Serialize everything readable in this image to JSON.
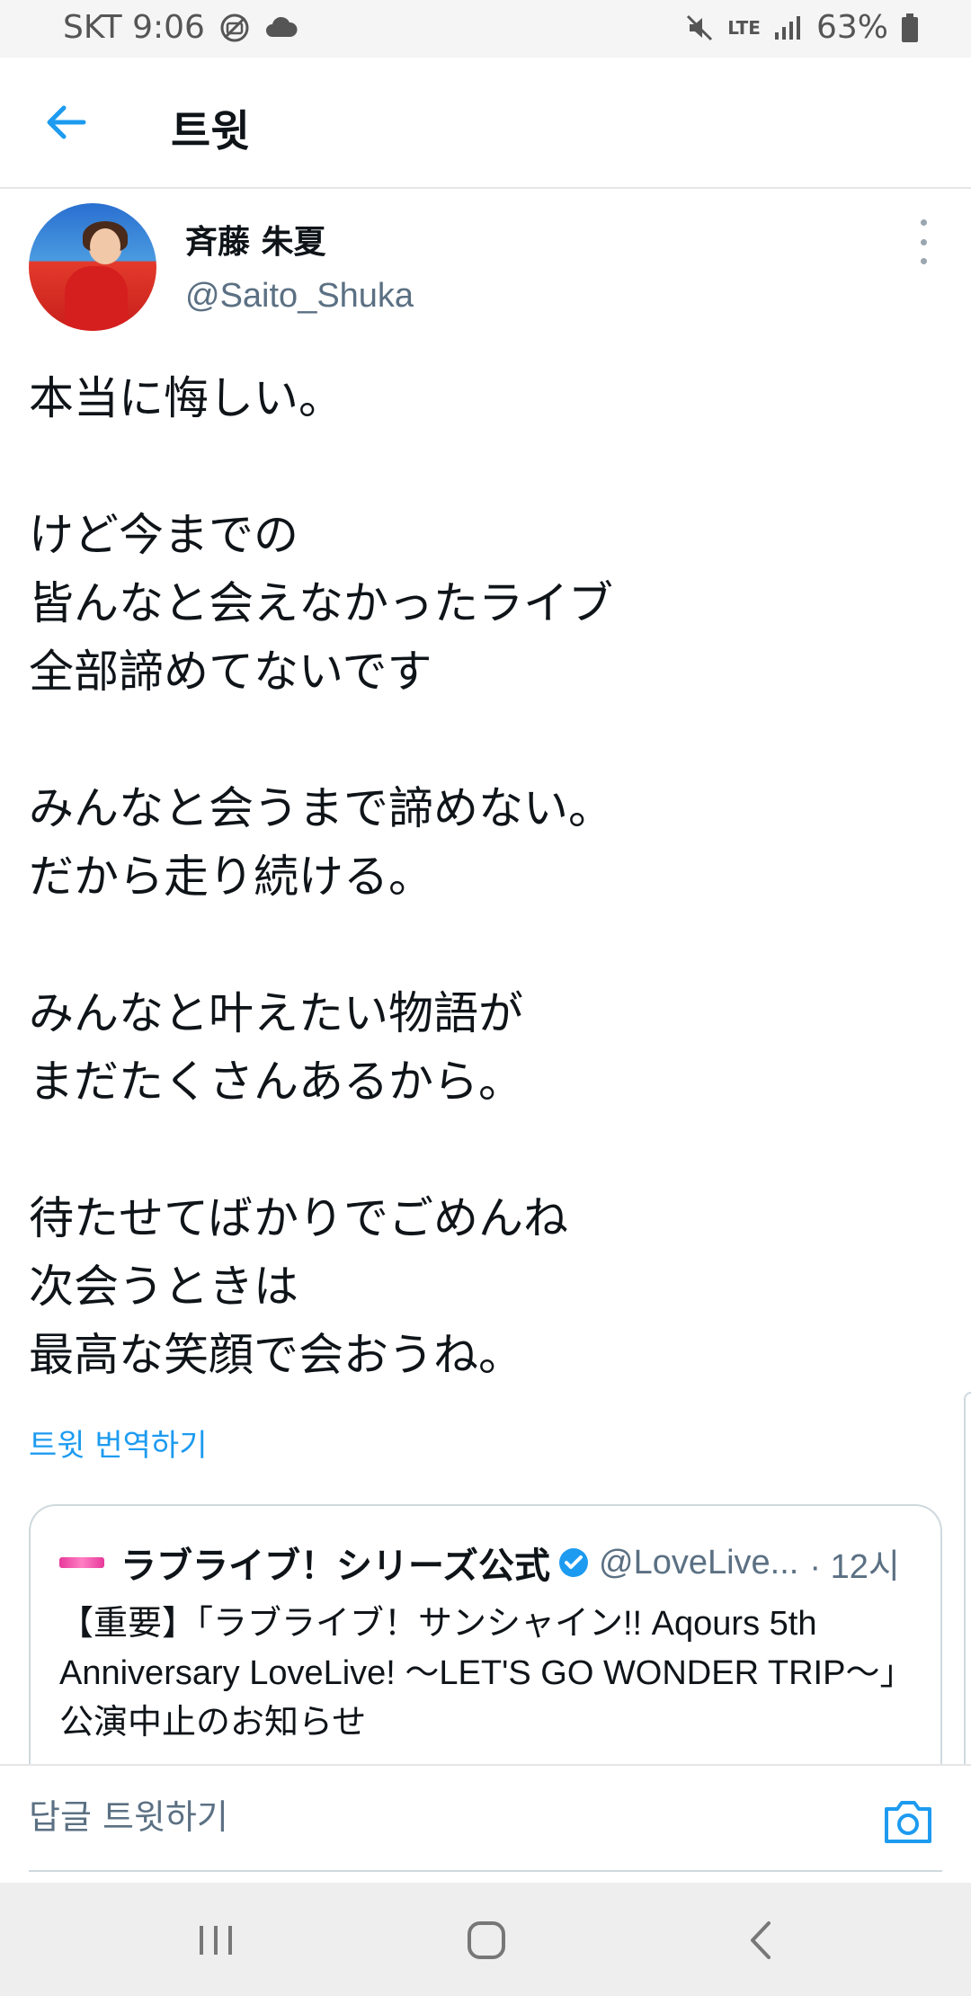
{
  "status_bar": {
    "carrier_time": "SKT 9:06",
    "network": "LTE",
    "battery": "63%"
  },
  "header": {
    "title": "트윗"
  },
  "tweet": {
    "display_name": "斉藤 朱夏",
    "handle": "@Saito_Shuka",
    "text": "本当に悔しい。\n\nけど今までの\n皆んなと会えなかったライブ\n全部諦めてないです\n\nみんなと会うまで諦めない。\nだから走り続ける。\n\nみんなと叶えたい物語が\nまだたくさんあるから。\n\n待たせてばかりでごめんね\n次会うときは\n最高な笑顔で会おうね。",
    "translate_label": "트윗 번역하기"
  },
  "quoted_tweet": {
    "display_name": "ラブライブ！シリーズ公式",
    "handle": "@LoveLive...",
    "time": "· 12시",
    "text": "【重要】「ラブライブ！サンシャイン!! Aqours 5th Anniversary LoveLive! ～LET'S GO WONDER TRIP～」\n公演中止のお知らせ"
  },
  "reply": {
    "placeholder": "답글 트윗하기"
  },
  "colors": {
    "accent": "#1d9bf0",
    "secondary_text": "#5b7083",
    "border": "#cfd9de"
  },
  "icons": {
    "back": "arrow-left-icon",
    "more": "more-vertical-icon",
    "verified": "verified-badge-icon",
    "camera": "camera-icon",
    "recents": "recents-icon",
    "home": "home-icon",
    "nav_back": "chevron-left-icon"
  }
}
